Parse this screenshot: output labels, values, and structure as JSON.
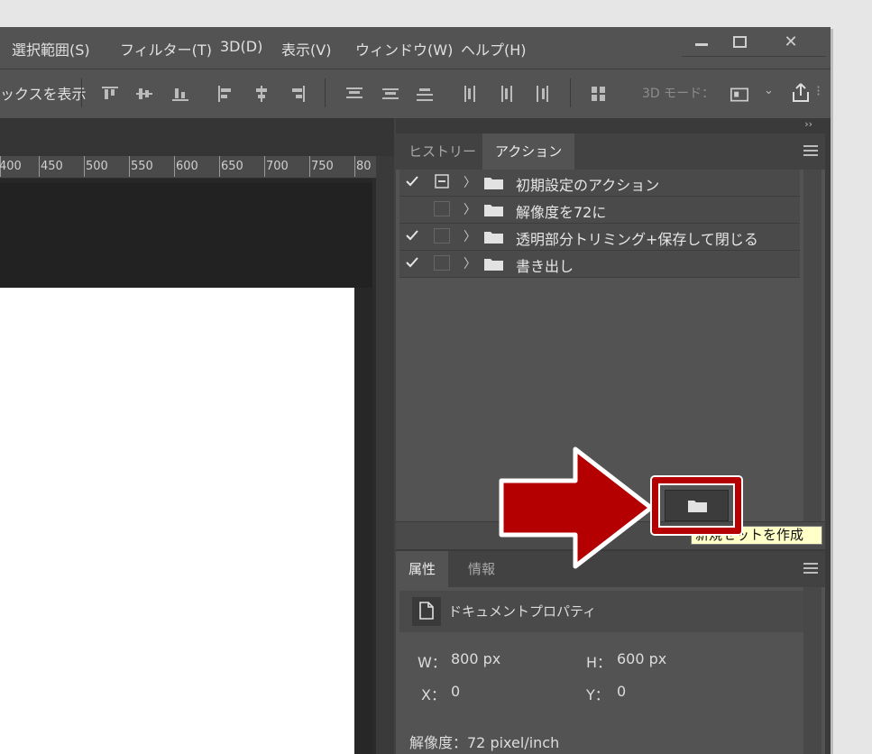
{
  "menu": {
    "items": [
      "選択範囲(S)",
      "フィルター(T)",
      "3D(D)",
      "表示(V)",
      "ウィンドウ(W)",
      "ヘルプ(H)"
    ],
    "window_controls": {
      "minimize": "—",
      "maximize": "□",
      "close": "✕"
    }
  },
  "options_bar": {
    "show_transform_label": "ックスを表示",
    "mode_label": "3D モード："
  },
  "ruler": {
    "ticks": [
      "400",
      "450",
      "500",
      "550",
      "600",
      "650",
      "700",
      "750",
      "80"
    ]
  },
  "panel_collapse": "››",
  "actions_panel": {
    "tabs": [
      "ヒストリー",
      "アクション"
    ],
    "active_tab": "アクション",
    "rows": [
      {
        "label": "初期設定のアクション",
        "checked": true,
        "dialog": true
      },
      {
        "label": "解像度を72に",
        "checked": false,
        "dialog": false
      },
      {
        "label": "透明部分トリミング+保存して閉じる",
        "checked": true,
        "dialog": false
      },
      {
        "label": "書き出し",
        "checked": true,
        "dialog": false
      }
    ]
  },
  "tooltip": {
    "text": "新規セットを作成"
  },
  "properties_panel": {
    "tabs": [
      "属性",
      "情報"
    ],
    "active_tab": "属性",
    "doc_props_label": "ドキュメントプロパティ",
    "w_label": "W：",
    "w_value": "800 px",
    "h_label": "H：",
    "h_value": "600 px",
    "x_label": "X：",
    "x_value": "0",
    "y_label": "Y：",
    "y_value": "0",
    "resolution": "解像度：72 pixel/inch"
  },
  "colors": {
    "highlight": "#b40000",
    "arrow": "#b40000",
    "tooltip_bg": "#ffffc8"
  }
}
